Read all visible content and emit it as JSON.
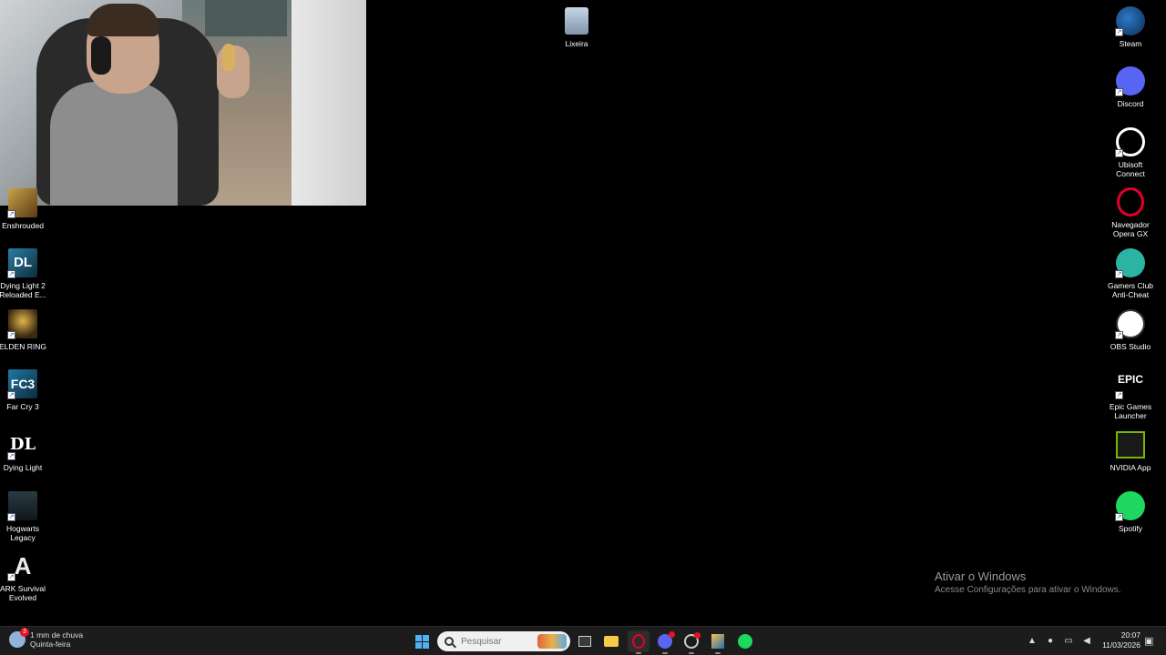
{
  "desktop": {
    "recycle_bin": {
      "label": "Lixeira",
      "icon": "recycle-bin-icon"
    },
    "left_icons": [
      {
        "label": "Enshrouded",
        "icon": "enshrouded-icon"
      },
      {
        "label": "Dying Light 2\nReloaded E...",
        "icon": "dying-light-2-icon",
        "glyph": "DL"
      },
      {
        "label": "ELDEN RING",
        "icon": "elden-ring-icon"
      },
      {
        "label": "Far Cry 3",
        "icon": "far-cry-3-icon",
        "glyph": "FC3"
      },
      {
        "label": "Dying Light",
        "icon": "dying-light-icon",
        "glyph": "DL"
      },
      {
        "label": "Hogwarts\nLegacy",
        "icon": "hogwarts-legacy-icon"
      },
      {
        "label": "ARK Survival\nEvolved",
        "icon": "ark-icon",
        "glyph": "A"
      }
    ],
    "right_icons": [
      {
        "label": "Steam",
        "icon": "steam-icon"
      },
      {
        "label": "Discord",
        "icon": "discord-icon"
      },
      {
        "label": "Ubisoft\nConnect",
        "icon": "ubisoft-connect-icon"
      },
      {
        "label": "Navegador\nOpera GX",
        "icon": "opera-gx-icon"
      },
      {
        "label": "Gamers Club\nAnti-Cheat",
        "icon": "gamers-club-icon"
      },
      {
        "label": "OBS Studio",
        "icon": "obs-studio-icon"
      },
      {
        "label": "Epic Games\nLauncher",
        "icon": "epic-games-icon",
        "glyph": "EPIC"
      },
      {
        "label": "NVIDIA App",
        "icon": "nvidia-icon"
      },
      {
        "label": "Spotify",
        "icon": "spotify-icon"
      }
    ],
    "watermark": {
      "title": "Ativar o Windows",
      "subtitle": "Acesse Configurações para ativar o Windows."
    }
  },
  "taskbar": {
    "weather": {
      "badge": "3",
      "line1": "1 mm de chuva",
      "line2": "Quinta-feira"
    },
    "search": {
      "placeholder": "Pesquisar"
    },
    "clock": {
      "time": "20:07",
      "date": "11/03/2026"
    },
    "colors": {
      "accent": "#4fb1f0",
      "background": "#1c1c1c"
    }
  }
}
